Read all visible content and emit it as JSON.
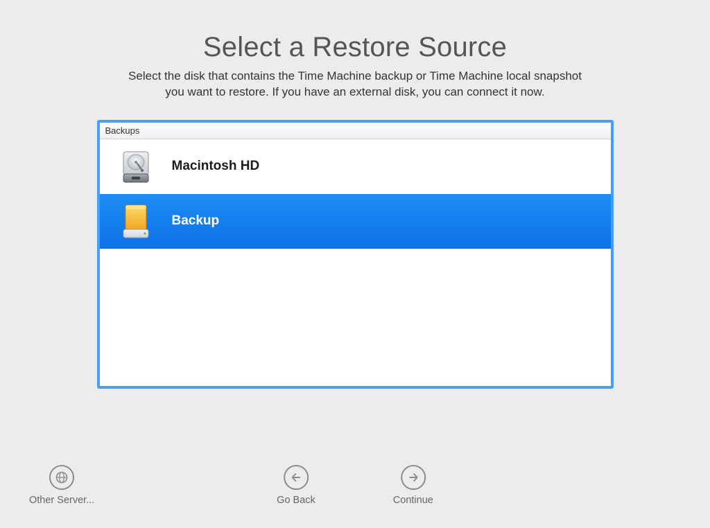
{
  "header": {
    "title": "Select a Restore Source",
    "subtitle_line1": "Select the disk that contains the Time Machine backup or Time Machine local snapshot",
    "subtitle_line2": "you want to restore. If you have an external disk, you can connect it now."
  },
  "list": {
    "heading": "Backups",
    "items": [
      {
        "icon": "internal-hd",
        "label": "Macintosh HD",
        "selected": false
      },
      {
        "icon": "external-hd",
        "label": "Backup",
        "selected": true
      }
    ]
  },
  "actions": {
    "other_server": "Other Server...",
    "go_back": "Go Back",
    "continue": "Continue"
  }
}
